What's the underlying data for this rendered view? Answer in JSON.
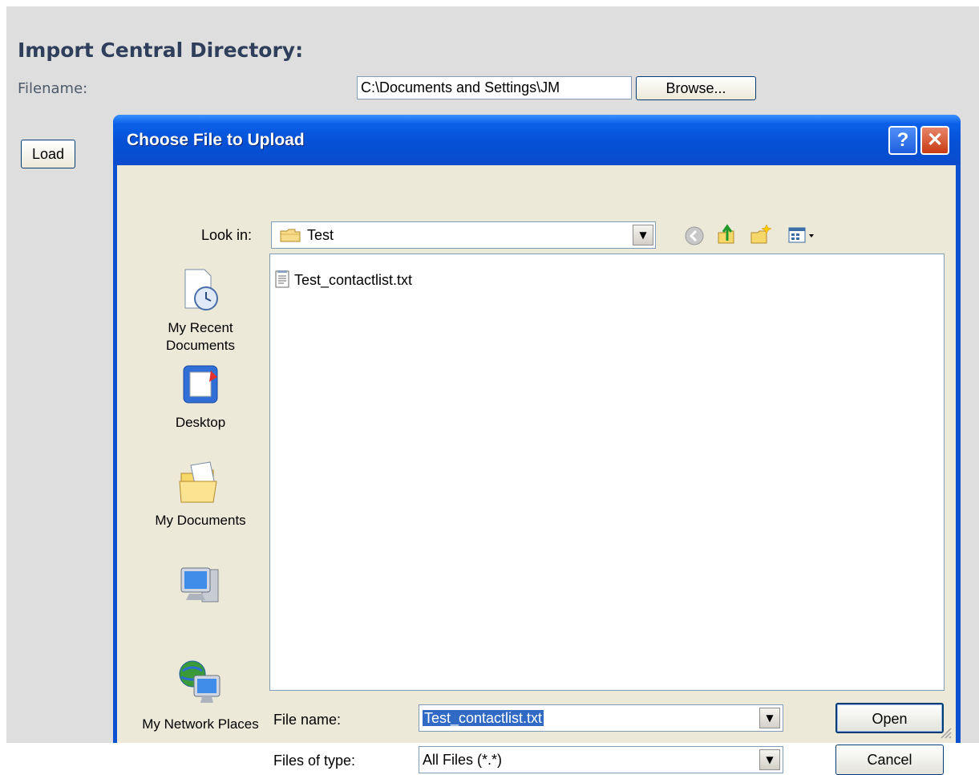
{
  "page": {
    "heading": "Import Central Directory:",
    "filename_label": "Filename:",
    "path_value": "C:\\Documents and Settings\\JM",
    "browse_label": "Browse...",
    "load_label": "Load"
  },
  "dialog": {
    "title": "Choose File to Upload",
    "help_label": "?",
    "close_label": "✕",
    "look_in_label": "Look in:",
    "look_in_value": "Test",
    "toolbar_icons": [
      "back-icon",
      "up-folder-icon",
      "new-folder-icon",
      "views-menu-icon"
    ],
    "places": [
      {
        "label": "My Recent Documents",
        "icon": "recent-documents-icon"
      },
      {
        "label": "Desktop",
        "icon": "desktop-icon"
      },
      {
        "label": "My Documents",
        "icon": "my-documents-icon"
      },
      {
        "label": "",
        "icon": "my-computer-icon"
      },
      {
        "label": "My Network Places",
        "icon": "network-places-icon"
      }
    ],
    "files": [
      {
        "name": "Test_contactlist.txt",
        "icon": "text-file-icon"
      }
    ],
    "file_name_label": "File name:",
    "file_name_value": "Test_contactlist.txt",
    "files_of_type_label": "Files of type:",
    "files_of_type_value": "All Files (*.*)",
    "open_label": "Open",
    "cancel_label": "Cancel"
  },
  "colors": {
    "title_bar": "#0a52d0",
    "dialog_body": "#ece9d8",
    "page_background": "#dedede",
    "heading_text": "#2e3e5b",
    "selection": "#316ac5"
  }
}
